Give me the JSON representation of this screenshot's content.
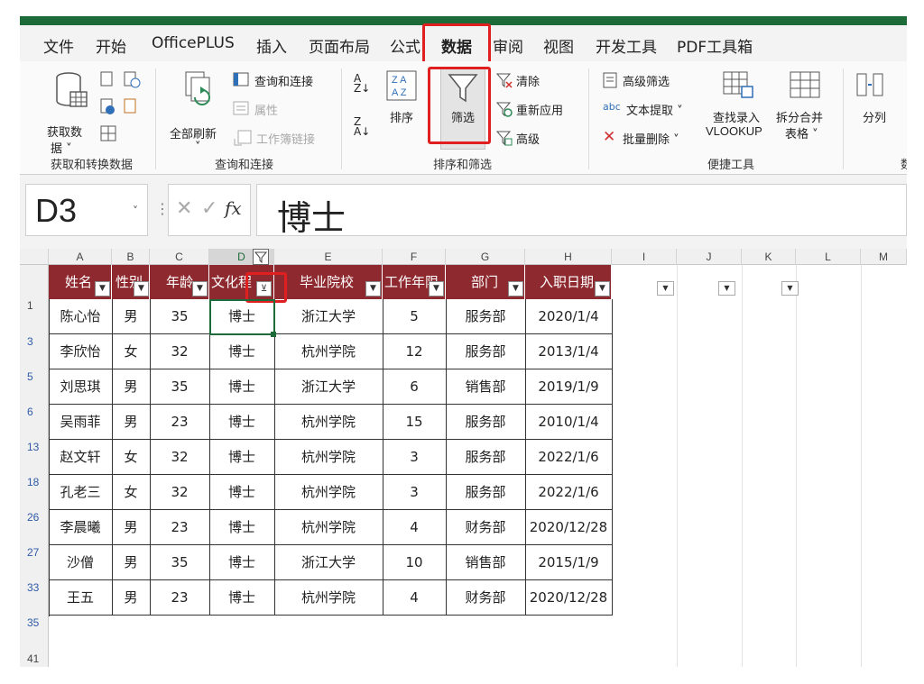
{
  "ribbon_tabs": [
    "文件",
    "开始",
    "OfficePLUS",
    "插入",
    "页面布局",
    "公式",
    "数据",
    "审阅",
    "视图",
    "开发工具",
    "PDF工具箱"
  ],
  "ribbon": {
    "get_data": "获取数",
    "get_data2": "据",
    "group_get": "获取和转换数据",
    "refresh_all": "全部刷新",
    "query_conn": "查询和连接",
    "properties": "属性",
    "workbook_links": "工作簿链接",
    "group_query": "查询和连接",
    "sort": "排序",
    "filter": "筛选",
    "clear": "清除",
    "reapply": "重新应用",
    "advanced": "高级",
    "group_sort": "排序和筛选",
    "adv_filter": "高级筛选",
    "text_extract": "文本提取",
    "batch_delete": "批量删除",
    "lookup_entry": "查找录入",
    "vlookup": "VLOOKUP",
    "split_merge": "拆分合并",
    "table": "表格",
    "group_quick": "便捷工具",
    "split_col": "分列",
    "cut_text": "数"
  },
  "formula_bar": {
    "name_box": "D3",
    "formula": "博士"
  },
  "columns": [
    "A",
    "B",
    "C",
    "D",
    "E",
    "F",
    "G",
    "H",
    "I",
    "J",
    "K",
    "L",
    "M"
  ],
  "headers": [
    "姓名",
    "性别",
    "年龄",
    "文化程度",
    "毕业院校",
    "工作年限",
    "部门",
    "入职日期"
  ],
  "header_display": [
    "姓名",
    "性别",
    "年龄",
    "文化程",
    "毕业院校",
    "工作年限",
    "部门",
    "入职日期"
  ],
  "row_numbers": [
    "1",
    "3",
    "5",
    "6",
    "13",
    "18",
    "26",
    "27",
    "33",
    "35",
    "41"
  ],
  "rows": [
    [
      "陈心怡",
      "男",
      "35",
      "博士",
      "浙江大学",
      "5",
      "服务部",
      "2020/1/4"
    ],
    [
      "李欣怡",
      "女",
      "32",
      "博士",
      "杭州学院",
      "12",
      "服务部",
      "2013/1/4"
    ],
    [
      "刘思琪",
      "男",
      "35",
      "博士",
      "浙江大学",
      "6",
      "销售部",
      "2019/1/9"
    ],
    [
      "吴雨菲",
      "男",
      "23",
      "博士",
      "杭州学院",
      "15",
      "服务部",
      "2010/1/4"
    ],
    [
      "赵文轩",
      "女",
      "32",
      "博士",
      "杭州学院",
      "3",
      "服务部",
      "2022/1/6"
    ],
    [
      "孔老三",
      "女",
      "32",
      "博士",
      "杭州学院",
      "3",
      "服务部",
      "2022/1/6"
    ],
    [
      "李晨曦",
      "男",
      "23",
      "博士",
      "杭州学院",
      "4",
      "财务部",
      "2020/12/28"
    ],
    [
      "沙僧",
      "男",
      "35",
      "博士",
      "浙江大学",
      "10",
      "销售部",
      "2015/1/9"
    ],
    [
      "王五",
      "男",
      "23",
      "博士",
      "杭州学院",
      "4",
      "财务部",
      "2020/12/28"
    ]
  ],
  "colors": {
    "header_bg": "#8e2a2f",
    "highlight": "#e02020",
    "accent": "#1e6b3a"
  }
}
